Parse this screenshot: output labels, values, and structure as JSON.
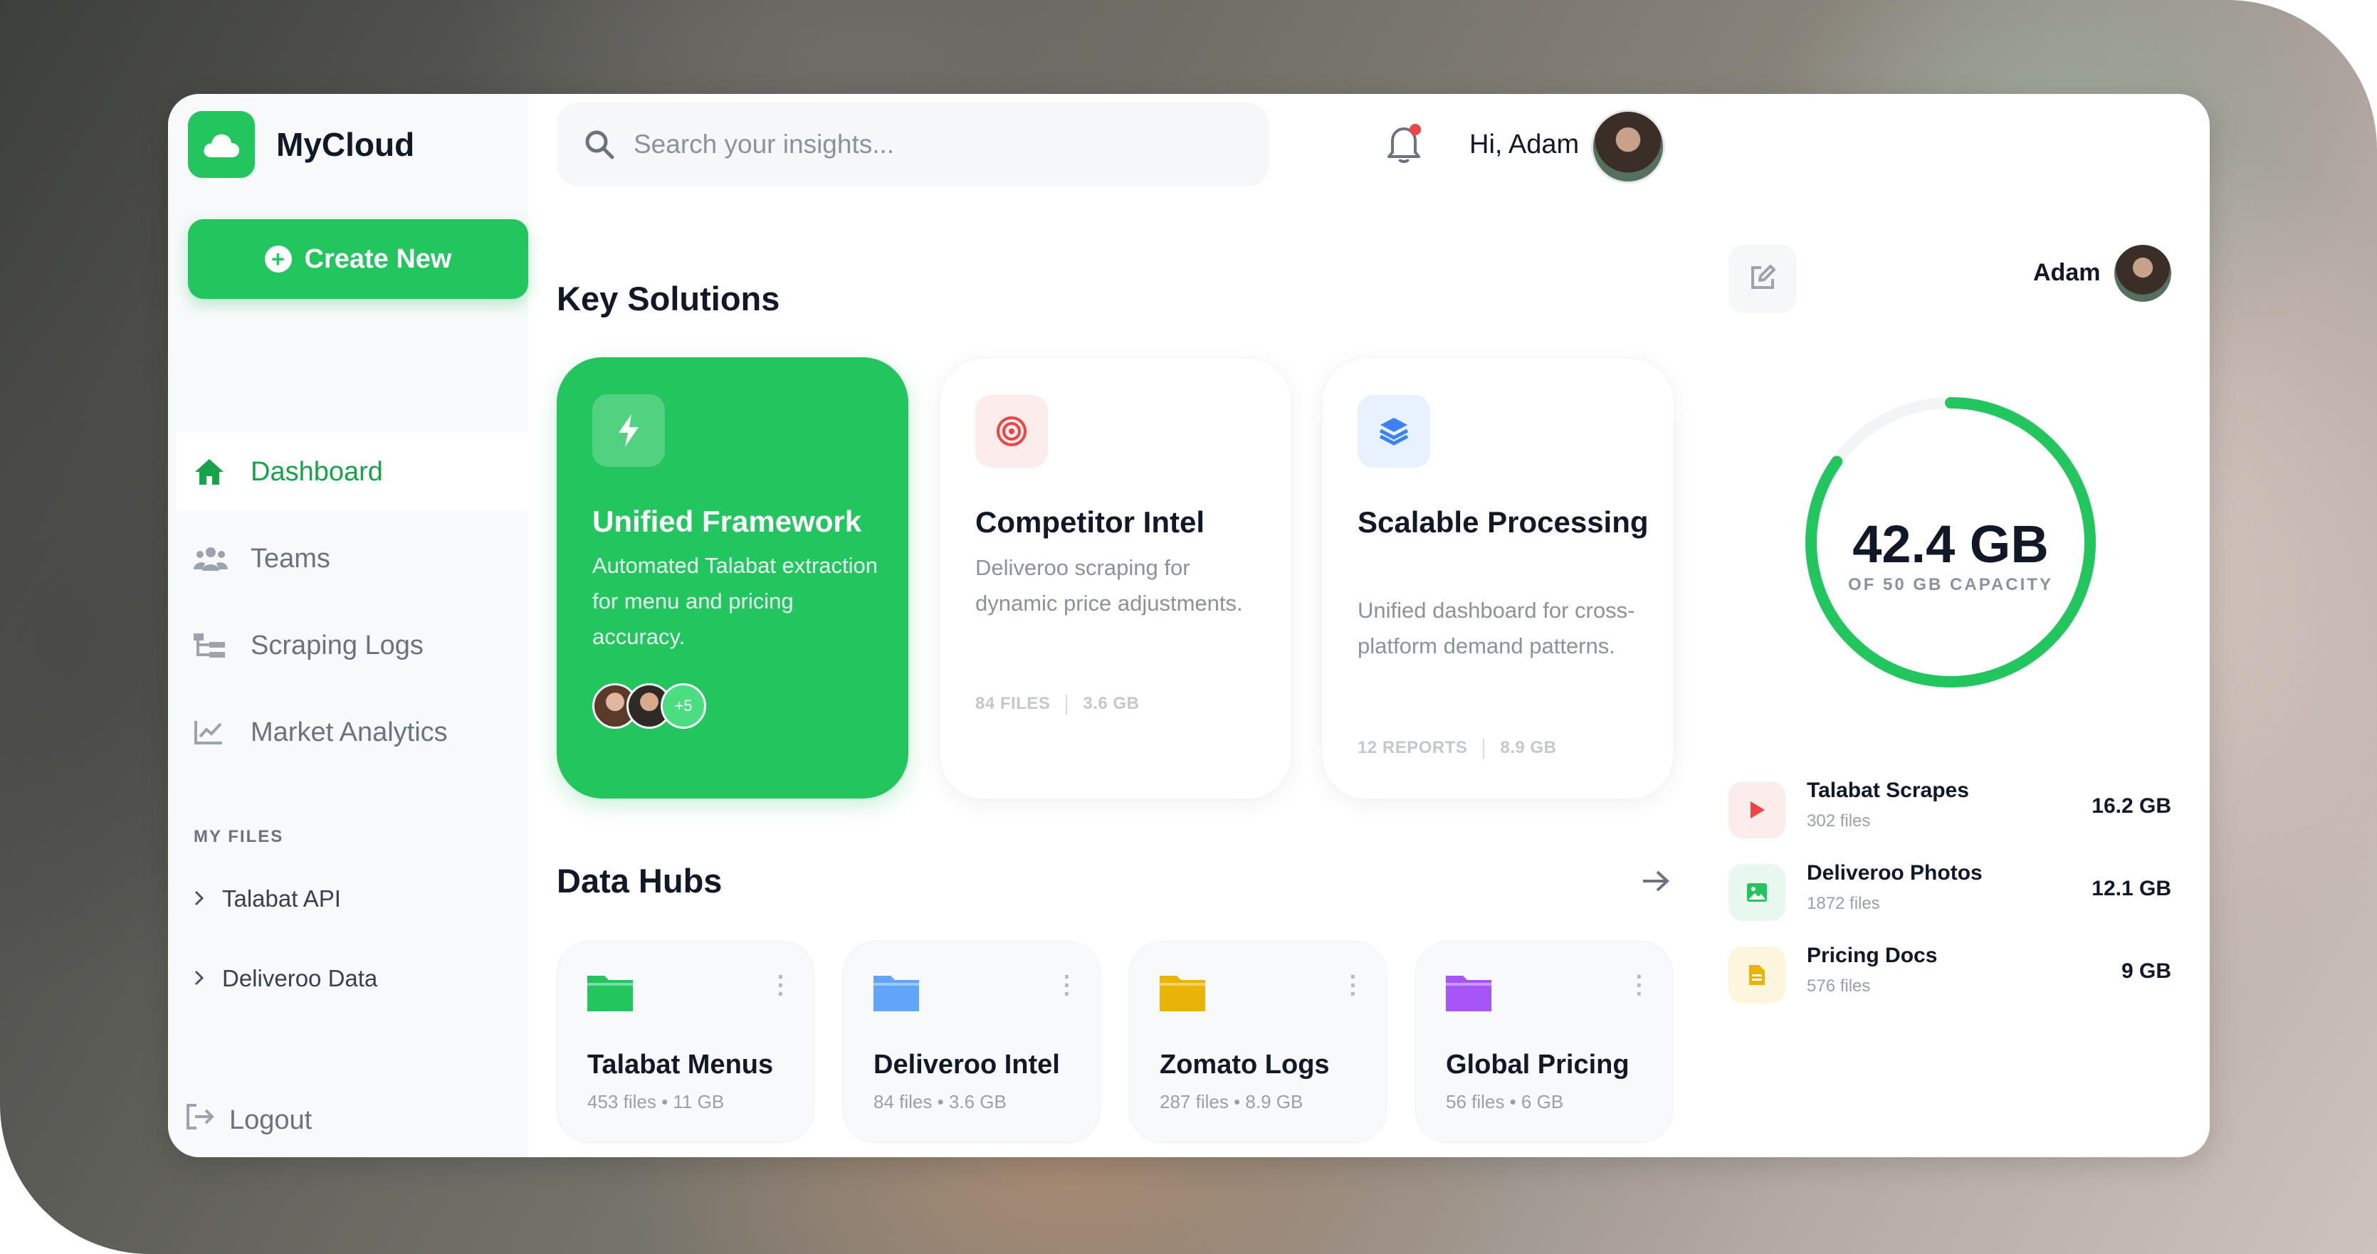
{
  "brand": {
    "name": "MyCloud",
    "accent": "#22c55e"
  },
  "sidebar": {
    "create_label": "Create New",
    "nav": [
      {
        "label": "Dashboard",
        "icon": "home-icon"
      },
      {
        "label": "Teams",
        "icon": "users-icon"
      },
      {
        "label": "Scraping Logs",
        "icon": "sitemap-icon"
      },
      {
        "label": "Market Analytics",
        "icon": "chart-line-icon"
      }
    ],
    "files_label": "MY FILES",
    "files": [
      {
        "label": "Talabat API"
      },
      {
        "label": "Deliveroo Data"
      }
    ],
    "logout_label": "Logout"
  },
  "header": {
    "search_placeholder": "Search your insights...",
    "greeting": "Hi, Adam"
  },
  "key_solutions": {
    "title": "Key Solutions",
    "cards": [
      {
        "title": "Unified Framework",
        "desc": "Automated Talabat extraction for menu and pricing accuracy.",
        "avatars_more": "+5"
      },
      {
        "title": "Competitor Intel",
        "desc": "Deliveroo scraping for dynamic price adjustments.",
        "meta_a": "84 FILES",
        "meta_b": "3.6 GB"
      },
      {
        "title": "Scalable Processing",
        "desc": "Unified dashboard for cross-platform demand patterns.",
        "meta_a": "12 REPORTS",
        "meta_b": "8.9 GB"
      }
    ]
  },
  "data_hubs": {
    "title": "Data Hubs",
    "items": [
      {
        "name": "Talabat Menus",
        "sub": "453 files • 11 GB",
        "color": "#22c55e"
      },
      {
        "name": "Deliveroo Intel",
        "sub": "84 files • 3.6 GB",
        "color": "#60a5fa"
      },
      {
        "name": "Zomato Logs",
        "sub": "287 files • 8.9 GB",
        "color": "#eab308"
      },
      {
        "name": "Global Pricing",
        "sub": "56 files • 6 GB",
        "color": "#a855f7"
      }
    ]
  },
  "storage": {
    "user": "Adam",
    "used": "42.4 GB",
    "capacity": "OF 50 GB CAPACITY",
    "fill_fraction": 0.848,
    "files": [
      {
        "name": "Talabat Scrapes",
        "count": "302 files",
        "size": "16.2 GB",
        "icon": "play-icon",
        "color": "#ef4444",
        "bg": "#fdecec"
      },
      {
        "name": "Deliveroo Photos",
        "count": "1872 files",
        "size": "12.1 GB",
        "icon": "image-icon",
        "color": "#22c55e",
        "bg": "#e8f8ee"
      },
      {
        "name": "Pricing Docs",
        "count": "576 files",
        "size": "9 GB",
        "icon": "document-icon",
        "color": "#eab308",
        "bg": "#fdf6dc"
      }
    ]
  }
}
